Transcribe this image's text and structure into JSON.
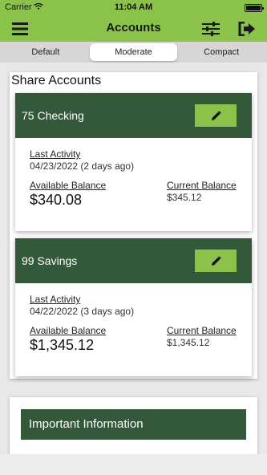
{
  "status_bar": {
    "carrier": "Carrier",
    "time": "11:04 AM"
  },
  "nav": {
    "title": "Accounts",
    "menu_icon": "hamburger-menu-icon",
    "filter_icon": "sliders-icon",
    "logout_icon": "logout-icon"
  },
  "view_modes": {
    "options": [
      "Default",
      "Moderate",
      "Compact"
    ],
    "selected": "Moderate"
  },
  "share_accounts": {
    "title": "Share Accounts",
    "accounts": [
      {
        "name": "75 Checking",
        "last_activity_label": "Last Activity",
        "last_activity": "04/23/2022 (2 days ago)",
        "available_label": "Available Balance",
        "available": "$340.08",
        "current_label": "Current Balance",
        "current": "$345.12"
      },
      {
        "name": "99 Savings",
        "last_activity_label": "Last Activity",
        "last_activity": "04/22/2022 (3 days ago)",
        "available_label": "Available Balance",
        "available": "$1,345.12",
        "current_label": "Current Balance",
        "current": "$1,345.12"
      }
    ]
  },
  "important_info": {
    "title": "Important Information"
  },
  "colors": {
    "brand": "#8bc34a",
    "header_dark": "#33593a"
  }
}
